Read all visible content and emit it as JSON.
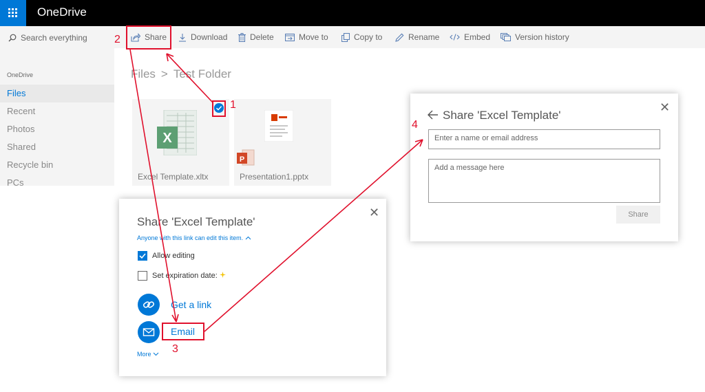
{
  "app": {
    "title": "OneDrive"
  },
  "search": {
    "placeholder": "Search everything"
  },
  "toolbar": {
    "items": [
      "Share",
      "Download",
      "Delete",
      "Move to",
      "Copy to",
      "Rename",
      "Embed",
      "Version history"
    ]
  },
  "nav": {
    "heading": "OneDrive",
    "items": [
      "Files",
      "Recent",
      "Photos",
      "Shared",
      "Recycle bin",
      "PCs"
    ]
  },
  "breadcrumb": {
    "root": "Files",
    "separator": ">",
    "current": "Test Folder"
  },
  "files": [
    {
      "name": "Excel Template.xltx"
    },
    {
      "name": "Presentation1.pptx"
    }
  ],
  "share_dialog": {
    "title": "Share 'Excel Template'",
    "link_permission": "Anyone with this link can edit this item.",
    "allow_editing": "Allow editing",
    "expiration": "Set expiration date:",
    "get_link": "Get a link",
    "email": "Email",
    "more": "More"
  },
  "email_dialog": {
    "title": "Share 'Excel Template'",
    "recipient_placeholder": "Enter a name or email address",
    "message_placeholder": "Add a message here",
    "share_button": "Share"
  },
  "annotations": [
    "1",
    "2",
    "3",
    "4"
  ],
  "colors": {
    "accent": "#0078d7",
    "annotation": "#e0102c",
    "topbar": "#000000"
  }
}
